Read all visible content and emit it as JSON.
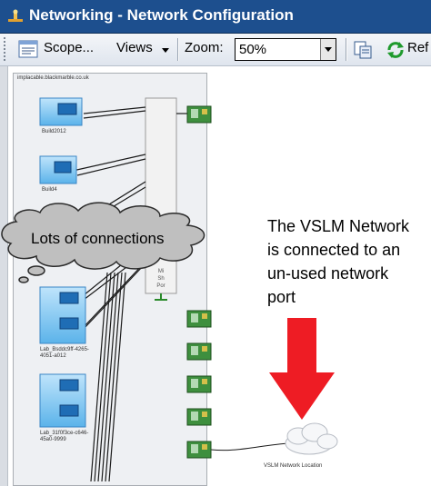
{
  "window": {
    "title": "Networking - Network Configuration"
  },
  "toolbar": {
    "scope_label": "Scope...",
    "views_label": "Views",
    "zoom_label": "Zoom:",
    "zoom_value": "50%",
    "refresh_label": "Ref"
  },
  "diagram": {
    "host_label": "implacable.blackmarble.co.uk",
    "vms": [
      "Build2012",
      "Build4",
      "Lab_Bsddc9ff-4265-4051-a012",
      "Lab_31f0f3ce-c646-45a0-9999"
    ],
    "network_label": "VSLM Network Location"
  },
  "annotations": {
    "lots_of_connections": "Lots of connections",
    "vslm_note": [
      "The VSLM Network",
      "is connected to an",
      "un-used network",
      "port"
    ]
  },
  "colors": {
    "arrow": "#ee1c24",
    "cloud": "#bfbfbf",
    "titlebar": "#1d4f8e"
  }
}
